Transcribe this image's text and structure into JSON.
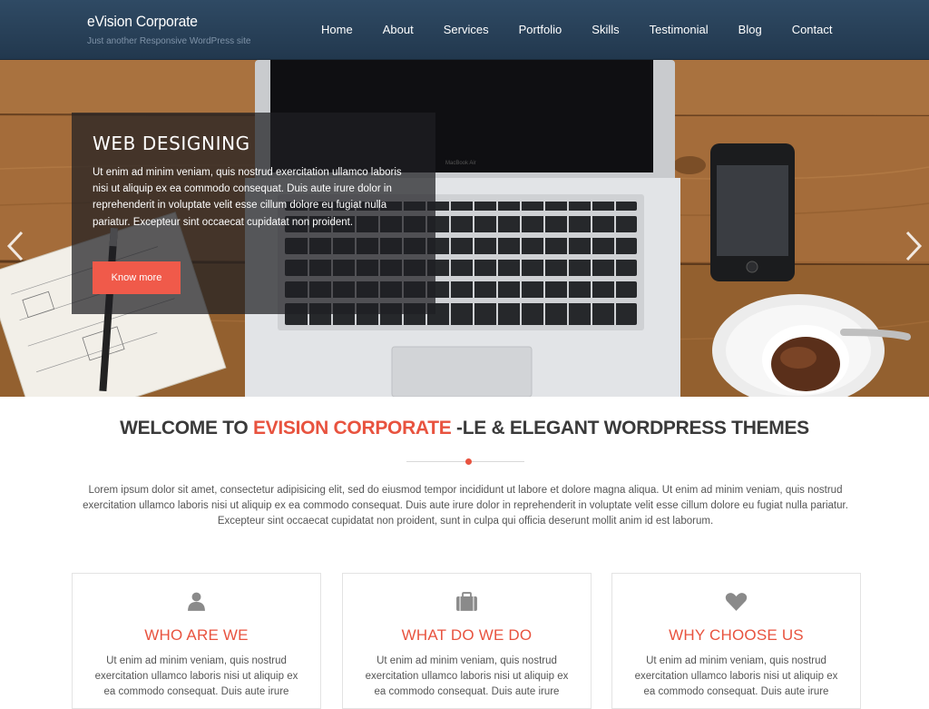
{
  "header": {
    "site_title": "eVision Corporate",
    "tagline": "Just another Responsive WordPress site",
    "nav": [
      "Home",
      "About",
      "Services",
      "Portfolio",
      "Skills",
      "Testimonial",
      "Blog",
      "Contact"
    ]
  },
  "hero": {
    "title": "WEB DESIGNING",
    "text": "Ut enim ad minim veniam, quis nostrud exercitation ullamco laboris nisi ut aliquip ex ea commodo consequat. Duis aute irure dolor in reprehenderit in voluptate velit esse cillum dolore eu fugiat nulla pariatur. Excepteur sint occaecat cupidatat non proident.",
    "button": "Know more",
    "laptop_label": "MacBook Air",
    "prev_icon": "chevron-left-icon",
    "next_icon": "chevron-right-icon"
  },
  "welcome": {
    "prefix": "WELCOME TO ",
    "brand": "EVISION CORPORATE",
    "suffix": " -LE & ELEGANT WORDPRESS THEMES",
    "text": "Lorem ipsum dolor sit amet, consectetur adipisicing elit, sed do eiusmod tempor incididunt ut labore et dolore magna aliqua. Ut enim ad minim veniam, quis nostrud exercitation ullamco laboris nisi ut aliquip ex ea commodo consequat. Duis aute irure dolor in reprehenderit in voluptate velit esse cillum dolore eu fugiat nulla pariatur. Excepteur sint occaecat cupidatat non proident, sunt in culpa qui officia deserunt mollit anim id est laborum."
  },
  "cards": [
    {
      "icon": "user-icon",
      "title": "WHO ARE WE",
      "text": "Ut enim ad minim veniam, quis nostrud exercitation ullamco laboris nisi ut aliquip ex ea commodo consequat. Duis aute irure"
    },
    {
      "icon": "briefcase-icon",
      "title": "WHAT DO WE DO",
      "text": "Ut enim ad minim veniam, quis nostrud exercitation ullamco laboris nisi ut aliquip ex ea commodo consequat. Duis aute irure"
    },
    {
      "icon": "heart-icon",
      "title": "WHY CHOOSE US",
      "text": "Ut enim ad minim veniam, quis nostrud exercitation ullamco laboris nisi ut aliquip ex ea commodo consequat. Duis aute irure"
    }
  ],
  "colors": {
    "header_bg": "#2a4259",
    "accent": "#e8533f",
    "button": "#f05a4a",
    "text": "#555555"
  }
}
